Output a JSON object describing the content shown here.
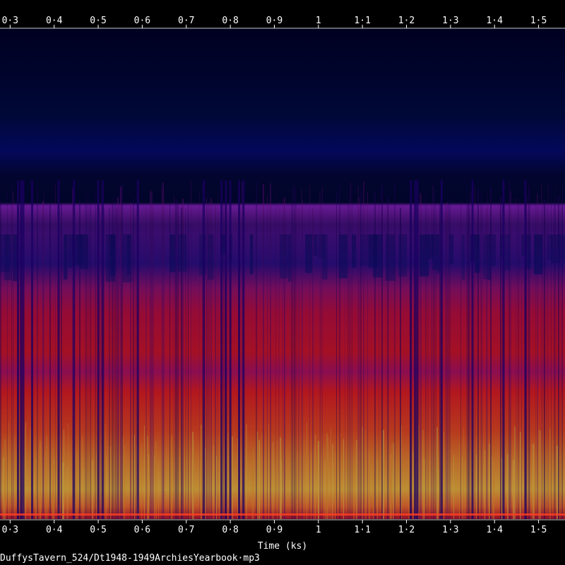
{
  "chart_data": {
    "type": "heatmap",
    "title": "",
    "xlabel": "Time (ks)",
    "ylabel": "",
    "x_ticks": [
      "0·3",
      "0·4",
      "0·5",
      "0·6",
      "0·7",
      "0·8",
      "0·9",
      "1",
      "1·1",
      "1·2",
      "1·3",
      "1·4",
      "1·5"
    ],
    "x_tick_values": [
      0.3,
      0.4,
      0.5,
      0.6,
      0.7,
      0.8,
      0.9,
      1.0,
      1.1,
      1.2,
      1.3,
      1.4,
      1.5
    ],
    "xlim": [
      0.277,
      1.56
    ],
    "ylim": [
      0,
      1
    ],
    "grid": false,
    "colormap": [
      "#000020",
      "#0a0a5a",
      "#3a1090",
      "#8a1aa8",
      "#d01050",
      "#ff1010",
      "#ff6010",
      "#ffb020",
      "#ffe060"
    ],
    "cutoff_level": 0.69,
    "dark_columns": [
      0.318,
      0.325,
      0.33,
      0.35,
      0.41,
      0.445,
      0.5,
      0.51,
      0.59,
      0.74,
      0.78,
      0.79,
      0.8,
      0.82,
      0.83,
      1.21,
      1.22,
      1.225,
      1.28,
      1.35,
      1.42,
      1.47
    ]
  },
  "footer": {
    "filename": "DuffysTavern_524/Dt1948-1949ArchiesYearbook·mp3"
  }
}
